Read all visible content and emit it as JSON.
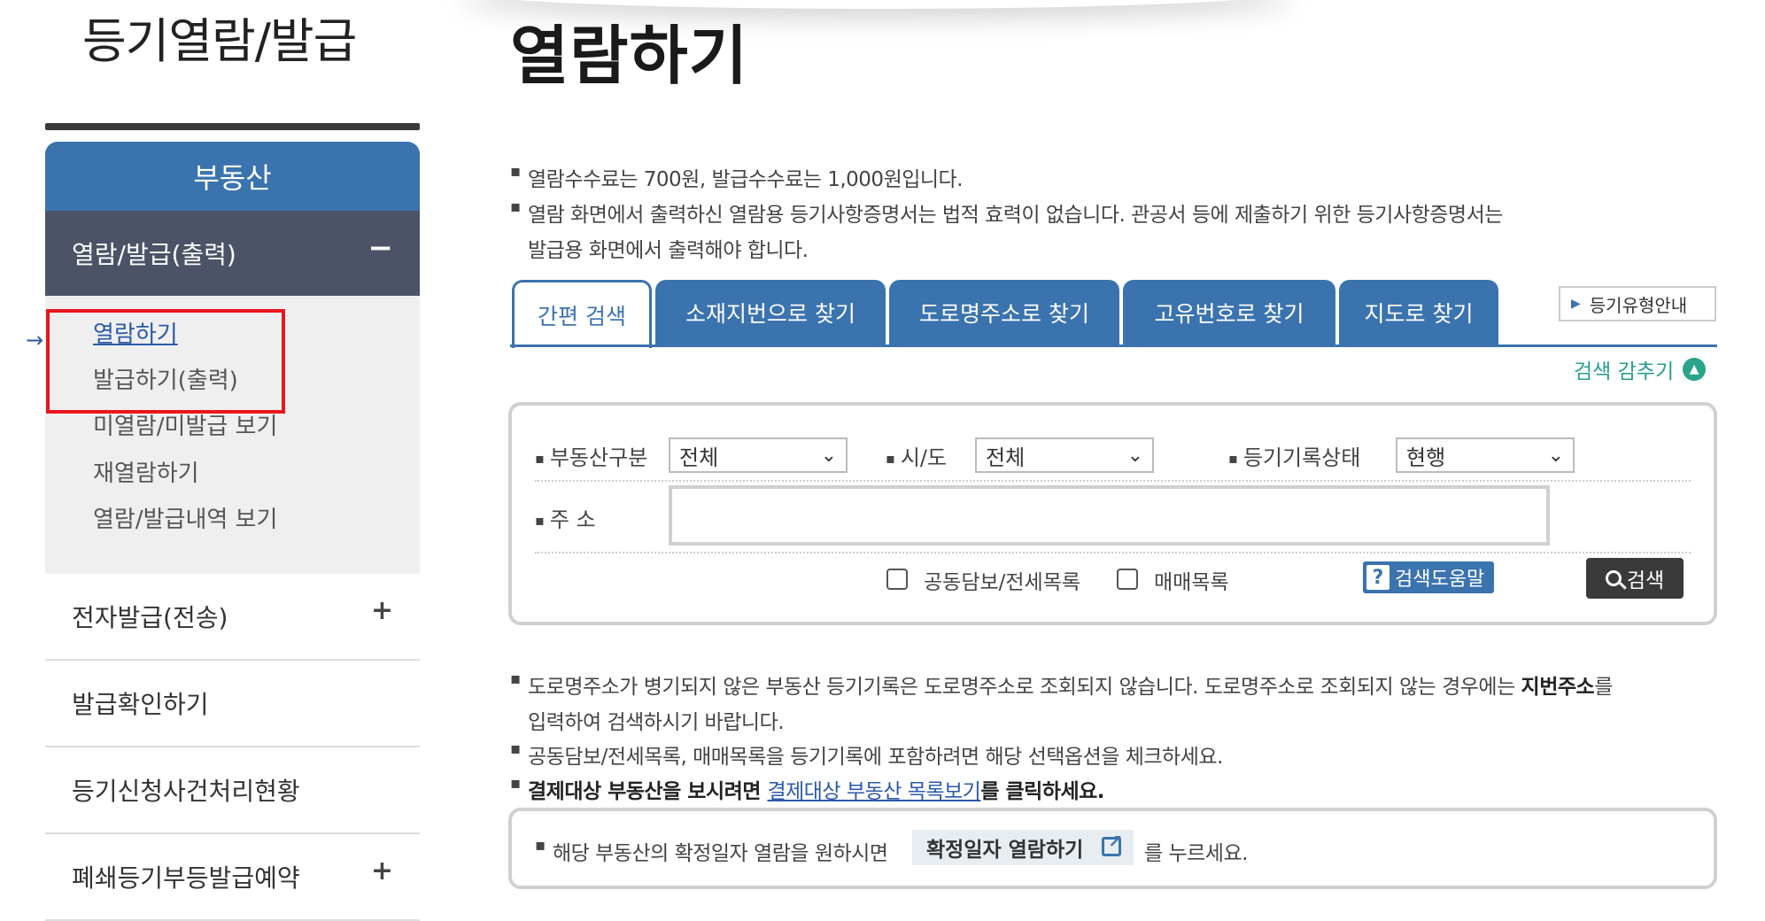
{
  "sidebar": {
    "section_title": "등기열람/발급",
    "category": "부동산",
    "active_group": "열람/발급(출력)",
    "active_group_toggle": "−",
    "sub_items": [
      {
        "label": "열람하기",
        "current": true
      },
      {
        "label": "발급하기(출력)"
      },
      {
        "label": "미열람/미발급 보기"
      },
      {
        "label": "재열람하기"
      },
      {
        "label": "열람/발급내역 보기"
      }
    ],
    "current_arrow": "→",
    "items": [
      {
        "label": "전자발급(전송)",
        "toggle": "+"
      },
      {
        "label": "발급확인하기"
      },
      {
        "label": "등기신청사건처리현황"
      },
      {
        "label": "폐쇄등기부등발급예약",
        "toggle": "+"
      }
    ]
  },
  "main": {
    "title": "열람하기",
    "notes_top": [
      "열람수수료는 700원, 발급수수료는 1,000원입니다.",
      "열람 화면에서 출력하신 열람용 등기사항증명서는 법적 효력이 없습니다. 관공서 등에 제출하기 위한 등기사항증명서는",
      "발급용 화면에서 출력해야 합니다."
    ],
    "tabs": [
      {
        "label": "간편 검색",
        "active": true
      },
      {
        "label": "소재지번으로 찾기"
      },
      {
        "label": "도로명주소로 찾기"
      },
      {
        "label": "고유번호로 찾기"
      },
      {
        "label": "지도로 찾기"
      }
    ],
    "guide_button": "등기유형안내",
    "collapse_label": "검색 감추기",
    "search": {
      "property_type_label": "부동산구분",
      "property_type_value": "전체",
      "sido_label": "시/도",
      "sido_value": "전체",
      "record_status_label": "등기기록상태",
      "record_status_value": "현행",
      "address_label": "주 소",
      "address_value": "",
      "checkbox1_label": "공동담보/전세목록",
      "checkbox2_label": "매매목록",
      "help_label": "검색도움말",
      "help_q": "?",
      "search_label": "검색"
    },
    "notes_bottom": {
      "line1_a": "도로명주소가 병기되지 않은 부동산 등기기록은 도로명주소로 조회되지 않습니다. 도로명주소로 조회되지 않는 경우에는 ",
      "line1_b": "지번주소",
      "line1_c": "를",
      "line2": "입력하여 검색하시기 바랍니다.",
      "line3": "공동담보/전세목록, 매매목록을 등기기록에 포함하려면 해당 선택옵션을 체크하세요.",
      "line4_a": "결제대상 부동산을 보시려면 ",
      "line4_link": "결제대상 부동산 목록보기",
      "line4_b": "를 클릭하세요."
    },
    "confirm": {
      "text_before": "해당 부동산의 확정일자 열람을 원하시면",
      "button": "확정일자 열람하기",
      "text_after": "를 누르세요."
    }
  },
  "colors": {
    "primary_blue": "#3b73ae",
    "active_group_bg": "#4c5367",
    "highlight_red": "#e8161c",
    "collapse_teal": "#2ba58a"
  }
}
